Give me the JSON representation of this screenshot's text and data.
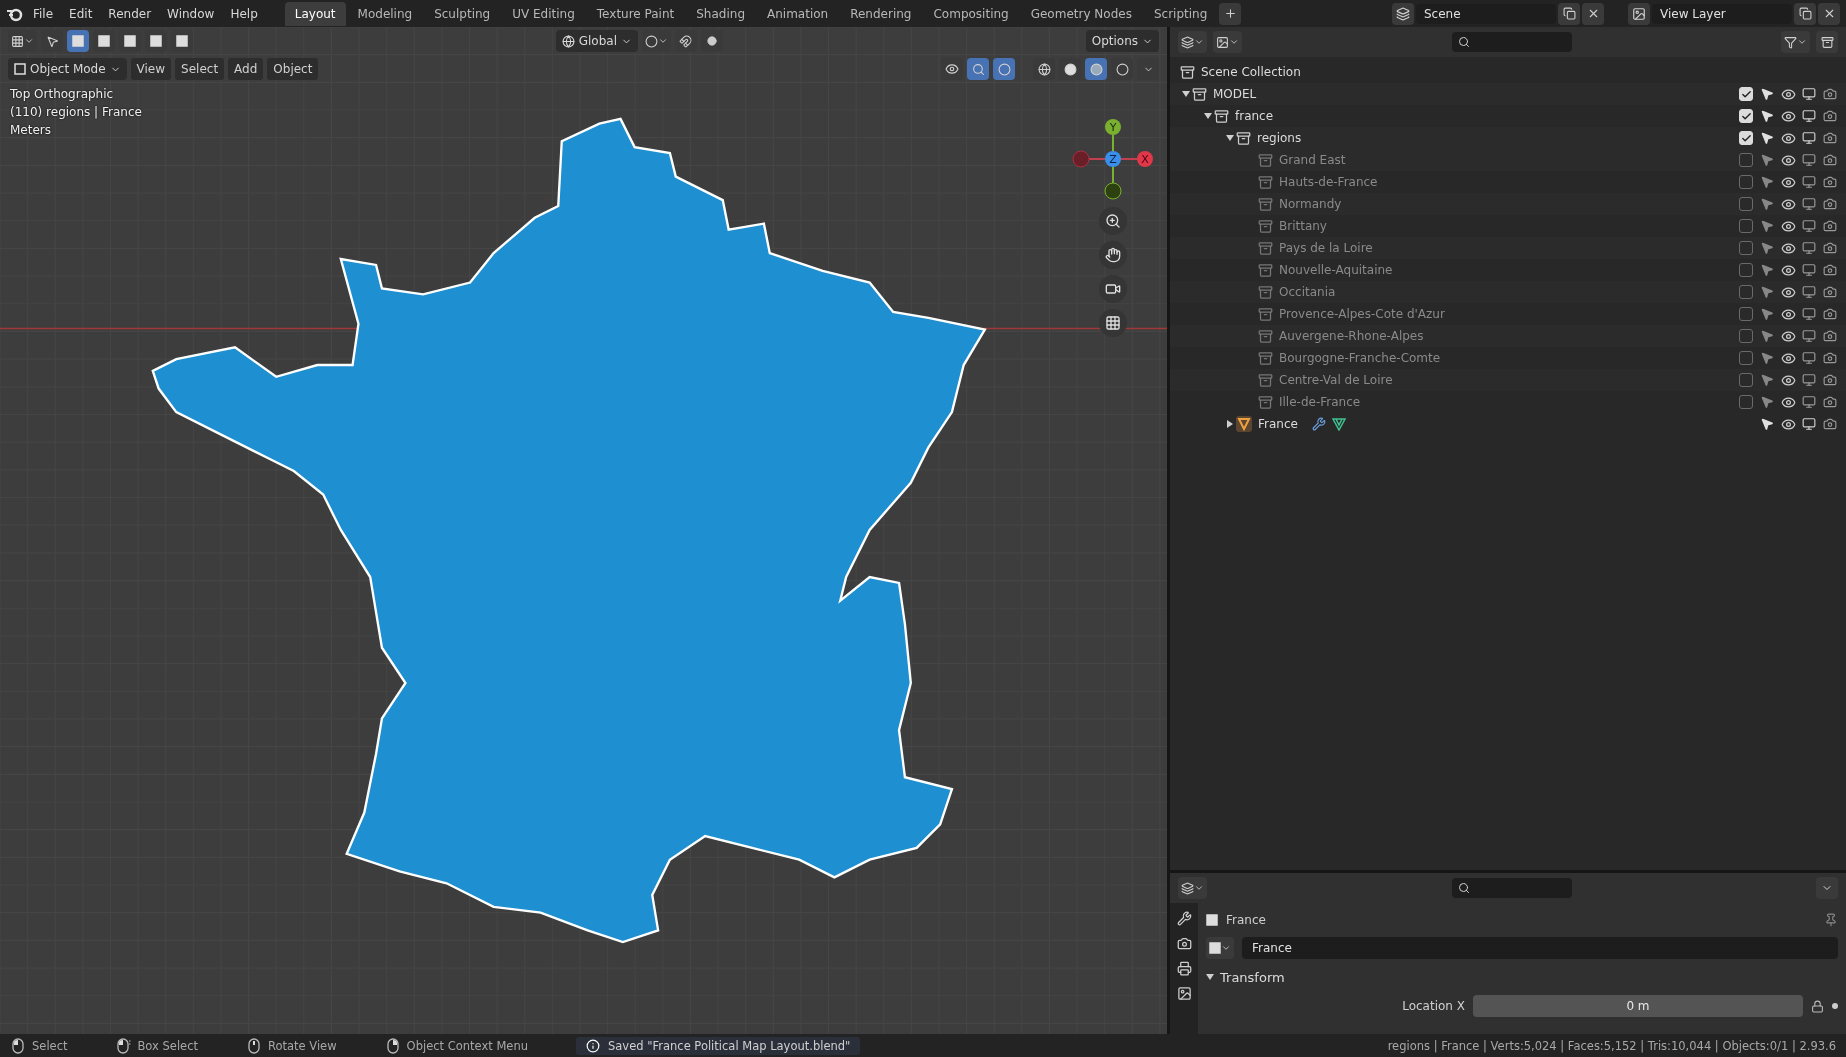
{
  "top_bar": {
    "menus": [
      "File",
      "Edit",
      "Render",
      "Window",
      "Help"
    ],
    "workspaces": [
      {
        "label": "Layout",
        "selected": true
      },
      {
        "label": "Modeling",
        "selected": false
      },
      {
        "label": "Sculpting",
        "selected": false
      },
      {
        "label": "UV Editing",
        "selected": false
      },
      {
        "label": "Texture Paint",
        "selected": false
      },
      {
        "label": "Shading",
        "selected": false
      },
      {
        "label": "Animation",
        "selected": false
      },
      {
        "label": "Rendering",
        "selected": false
      },
      {
        "label": "Compositing",
        "selected": false
      },
      {
        "label": "Geometry Nodes",
        "selected": false
      },
      {
        "label": "Scripting",
        "selected": false
      }
    ],
    "scene": "Scene",
    "view_layer": "View Layer"
  },
  "viewport": {
    "orientation": "Global",
    "options": "Options",
    "mode": "Object Mode",
    "menus": [
      "View",
      "Select",
      "Add",
      "Object"
    ],
    "select_modes": [
      {
        "selected": true
      },
      {
        "selected": false
      },
      {
        "selected": false
      },
      {
        "selected": false
      },
      {
        "selected": false
      }
    ],
    "shading": [
      {
        "kind": "wireframe",
        "selected": false
      },
      {
        "kind": "solid",
        "selected": false
      },
      {
        "kind": "material",
        "selected": true
      },
      {
        "kind": "rendered",
        "selected": false
      }
    ],
    "overlay_lines": [
      "Top Orthographic",
      "(110) regions | France",
      "Meters"
    ],
    "gizmo_axes": [
      "Y",
      "Z",
      "X"
    ]
  },
  "outliner": {
    "tree": [
      {
        "label": "Scene Collection",
        "kind": "scene",
        "children": [
          {
            "label": "MODEL",
            "kind": "collection",
            "expanded": true,
            "checked": true,
            "children": [
              {
                "label": "france",
                "kind": "collection",
                "expanded": true,
                "checked": true,
                "children": [
                  {
                    "label": "regions",
                    "kind": "collection",
                    "expanded": true,
                    "checked": true,
                    "children": [
                      {
                        "label": "Grand East",
                        "kind": "collection",
                        "checked": false
                      },
                      {
                        "label": "Hauts-de-France",
                        "kind": "collection",
                        "checked": false
                      },
                      {
                        "label": "Normandy",
                        "kind": "collection",
                        "checked": false
                      },
                      {
                        "label": "Brittany",
                        "kind": "collection",
                        "checked": false
                      },
                      {
                        "label": "Pays de la Loire",
                        "kind": "collection",
                        "checked": false
                      },
                      {
                        "label": "Nouvelle-Aquitaine",
                        "kind": "collection",
                        "checked": false
                      },
                      {
                        "label": "Occitania",
                        "kind": "collection",
                        "checked": false
                      },
                      {
                        "label": "Provence-Alpes-Cote d'Azur",
                        "kind": "collection",
                        "checked": false
                      },
                      {
                        "label": "Auvergene-Rhone-Alpes",
                        "kind": "collection",
                        "checked": false
                      },
                      {
                        "label": "Bourgogne-Franche-Comte",
                        "kind": "collection",
                        "checked": false
                      },
                      {
                        "label": "Centre-Val de Loire",
                        "kind": "collection",
                        "checked": false
                      },
                      {
                        "label": "Ille-de-France",
                        "kind": "collection",
                        "checked": false
                      }
                    ]
                  },
                  {
                    "label": "France",
                    "kind": "object",
                    "expanded": false
                  }
                ]
              }
            ]
          }
        ]
      }
    ]
  },
  "properties": {
    "object_name": "France",
    "datablock": "France",
    "panel": {
      "title": "Transform",
      "expanded": true
    },
    "fields": [
      {
        "label": "Location X",
        "value": "0 m"
      }
    ]
  },
  "status_bar": {
    "hints": [
      {
        "kind": "left",
        "label": "Select"
      },
      {
        "kind": "drag",
        "label": "Box Select"
      },
      {
        "kind": "middle",
        "label": "Rotate View"
      },
      {
        "kind": "right",
        "label": "Object Context Menu"
      }
    ],
    "message": "Saved \"France Political Map Layout.blend\"",
    "stats": "regions | France | Verts:5,024 | Faces:5,152 | Tris:10,044 | Objects:0/1 | 2.93.6"
  }
}
